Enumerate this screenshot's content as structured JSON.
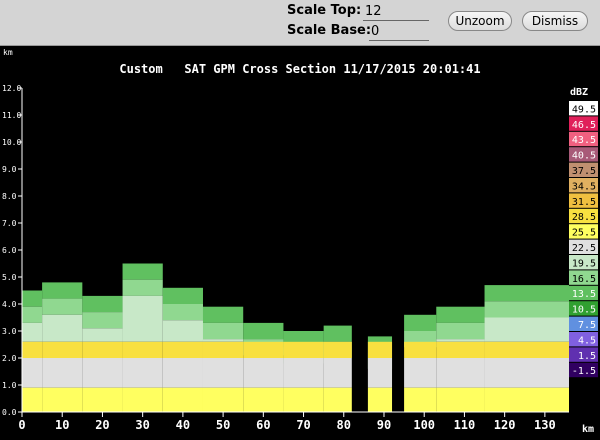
{
  "toolbar": {
    "scale_top_label": "Scale Top:",
    "scale_top_value": "12",
    "scale_base_label": "Scale Base:",
    "scale_base_value": "0",
    "unzoom_label": "Unzoom",
    "dismiss_label": "Dismiss"
  },
  "plot": {
    "title": "Custom   SAT GPM Cross Section 11/17/2015 20:01:41",
    "y_unit": "km",
    "x_unit": "km",
    "legend_unit": "dBZ"
  },
  "chart_data": {
    "type": "heatmap",
    "x_ticks": [
      0,
      10,
      20,
      30,
      40,
      50,
      60,
      70,
      80,
      90,
      100,
      110,
      120,
      130
    ],
    "y_ticks": [
      "0.0",
      "1.0",
      "2.0",
      "3.0",
      "4.0",
      "5.0",
      "6.0",
      "7.0",
      "8.0",
      "9.0",
      "10.0",
      "11.0",
      "12.0"
    ],
    "xlim": [
      0,
      136
    ],
    "ylim": [
      0,
      12
    ],
    "legend": [
      {
        "label": "49.5",
        "color": "#ffffff"
      },
      {
        "label": "46.5",
        "color": "#e0205a"
      },
      {
        "label": "43.5",
        "color": "#f06080"
      },
      {
        "label": "40.5",
        "color": "#a85a78"
      },
      {
        "label": "37.5",
        "color": "#c09070"
      },
      {
        "label": "34.5",
        "color": "#e0b060"
      },
      {
        "label": "31.5",
        "color": "#f0c040"
      },
      {
        "label": "28.5",
        "color": "#f8e040"
      },
      {
        "label": "25.5",
        "color": "#ffff60"
      },
      {
        "label": "22.5",
        "color": "#e0e0e0"
      },
      {
        "label": "19.5",
        "color": "#c8e8c8"
      },
      {
        "label": "16.5",
        "color": "#90d890"
      },
      {
        "label": "13.5",
        "color": "#60c060"
      },
      {
        "label": "10.5",
        "color": "#30a030"
      },
      {
        "label": "7.5",
        "color": "#6090e0"
      },
      {
        "label": "4.5",
        "color": "#8060e0"
      },
      {
        "label": "1.5",
        "color": "#6030b0"
      },
      {
        "label": "-1.5",
        "color": "#300060"
      }
    ],
    "profile": [
      {
        "x0": 0,
        "x1": 5,
        "top": 4.5
      },
      {
        "x0": 5,
        "x1": 15,
        "top": 4.8
      },
      {
        "x0": 15,
        "x1": 25,
        "top": 4.3
      },
      {
        "x0": 25,
        "x1": 35,
        "top": 5.5
      },
      {
        "x0": 35,
        "x1": 45,
        "top": 4.6
      },
      {
        "x0": 45,
        "x1": 55,
        "top": 3.9
      },
      {
        "x0": 55,
        "x1": 65,
        "top": 3.3
      },
      {
        "x0": 65,
        "x1": 75,
        "top": 3.0
      },
      {
        "x0": 75,
        "x1": 82,
        "top": 3.2
      },
      {
        "x0": 86,
        "x1": 92,
        "top": 2.8
      },
      {
        "x0": 95,
        "x1": 103,
        "top": 3.6
      },
      {
        "x0": 103,
        "x1": 115,
        "top": 3.9
      },
      {
        "x0": 115,
        "x1": 136,
        "top": 4.7
      }
    ]
  }
}
